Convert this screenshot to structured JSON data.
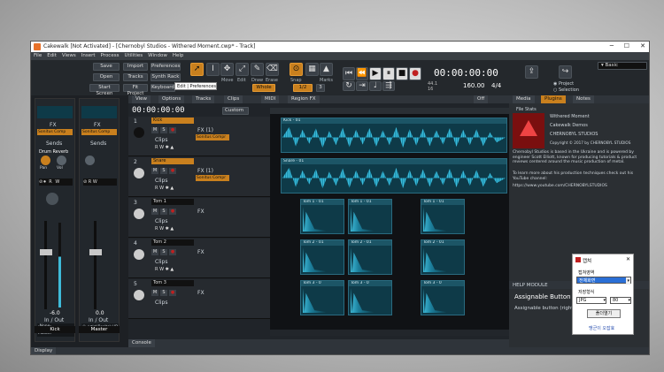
{
  "window": {
    "title": "Cakewalk [Not Activated] - [Chernobyl Studios - Withered Moment.cwp* - Track]"
  },
  "menu": [
    "File",
    "Edit",
    "Views",
    "Insert",
    "Process",
    "Utilities",
    "Window",
    "Help"
  ],
  "control_bar": {
    "buttons": {
      "save": "Save",
      "import": "Import",
      "preferences": "Preferences",
      "open": "Open",
      "tracks": "Tracks",
      "synth_rack": "Synth Rack",
      "start_screen": "Start Screen",
      "fit_project": "Fit Project",
      "keyboard": "Keyboard"
    },
    "tooltip": "Edit | Preferences",
    "tools": {
      "move": "Move",
      "edit": "Edit",
      "draw": "Draw",
      "erase": "Erase",
      "snap": "Snap",
      "marks": "Marks"
    },
    "snap_value": "Whole",
    "snap_grid": "1/2",
    "marks_value": "3",
    "time": "00:00:00:00",
    "bars_l": "44.1",
    "bars_r": "16",
    "tempo": "160.00",
    "meter": "4/4",
    "workspace": "Basic",
    "radio_project": "Project",
    "radio_selection": "Selection"
  },
  "strip": {
    "fx": "FX",
    "fx_name": "Sonitus Comp",
    "sends": "Sends",
    "send_name": "Drum Reverb",
    "pan": "Pan",
    "vol": "Vol",
    "ch_left_value": "-6.0",
    "ch_right_value": "0.0",
    "inout": "In / Out",
    "inout_right": "In / Out",
    "in_left": "-None-",
    "out_left": "Master",
    "in_right": "Ⓜ 스피커(Realtek HD",
    "ch_left_name": "Kick",
    "ch_right_name": "Master",
    "display_tab": "Display"
  },
  "trackview": {
    "menu": [
      "View",
      "Options",
      "Tracks",
      "Clips",
      "MIDI",
      "Region FX"
    ],
    "time": "00:00:00:00",
    "custom": "Custom",
    "off": "Off",
    "tracks": [
      {
        "num": "1",
        "name": "Kick",
        "fx": "FX (1)",
        "fx_item": "Sonitus Compr",
        "clips": "Clips"
      },
      {
        "num": "2",
        "name": "Snare",
        "fx": "FX (1)",
        "fx_item": "Sonitus Compr",
        "clips": "Clips"
      },
      {
        "num": "3",
        "name": "Tom 1",
        "fx": "FX",
        "clips": "Clips"
      },
      {
        "num": "4",
        "name": "Tom 2",
        "fx": "FX",
        "clips": "Clips"
      },
      {
        "num": "5",
        "name": "Tom 3",
        "fx": "FX",
        "clips": "Clips"
      }
    ],
    "clip_labels": {
      "kick": "Kick - 01",
      "snare": "Snare - 01",
      "tom1": "Tom 1 - 01",
      "tom2": "Tom 2 - 01",
      "tom3": "Tom 3 - 0"
    },
    "console_tab": "Console"
  },
  "browser": {
    "tabs": [
      "Media",
      "Plugins",
      "Notes"
    ],
    "file_stats": "File Stats",
    "info": [
      "Withered Moment",
      "Cakewalk Demos",
      "CHERNOBYL STUDIOS",
      "Copyright © 2017 by CHERNOBYL STUDIOS"
    ],
    "desc": "Chernobyl Studios is based in the Ukraine and is powered by engineer Scott Elliott, known for producing tutorials & product reviews centered around the music production of metal.",
    "desc2": "To learn more about his production techniques check out his YouTube channel:",
    "url": "https://www.youtube.com/CHERNOBYLSTUDIOS",
    "help_title": "HELP MODULE",
    "help_heading": "Assignable Button",
    "help_text": "Assignable button (right"
  },
  "popup": {
    "title": "캡쳐",
    "area_label": "캡쳐영역",
    "area_value": "전체화면",
    "format_label": "저장형식",
    "format_value": "JPG",
    "quality": "80",
    "button": "폴더열기",
    "link": "맹군이 오잡효"
  }
}
